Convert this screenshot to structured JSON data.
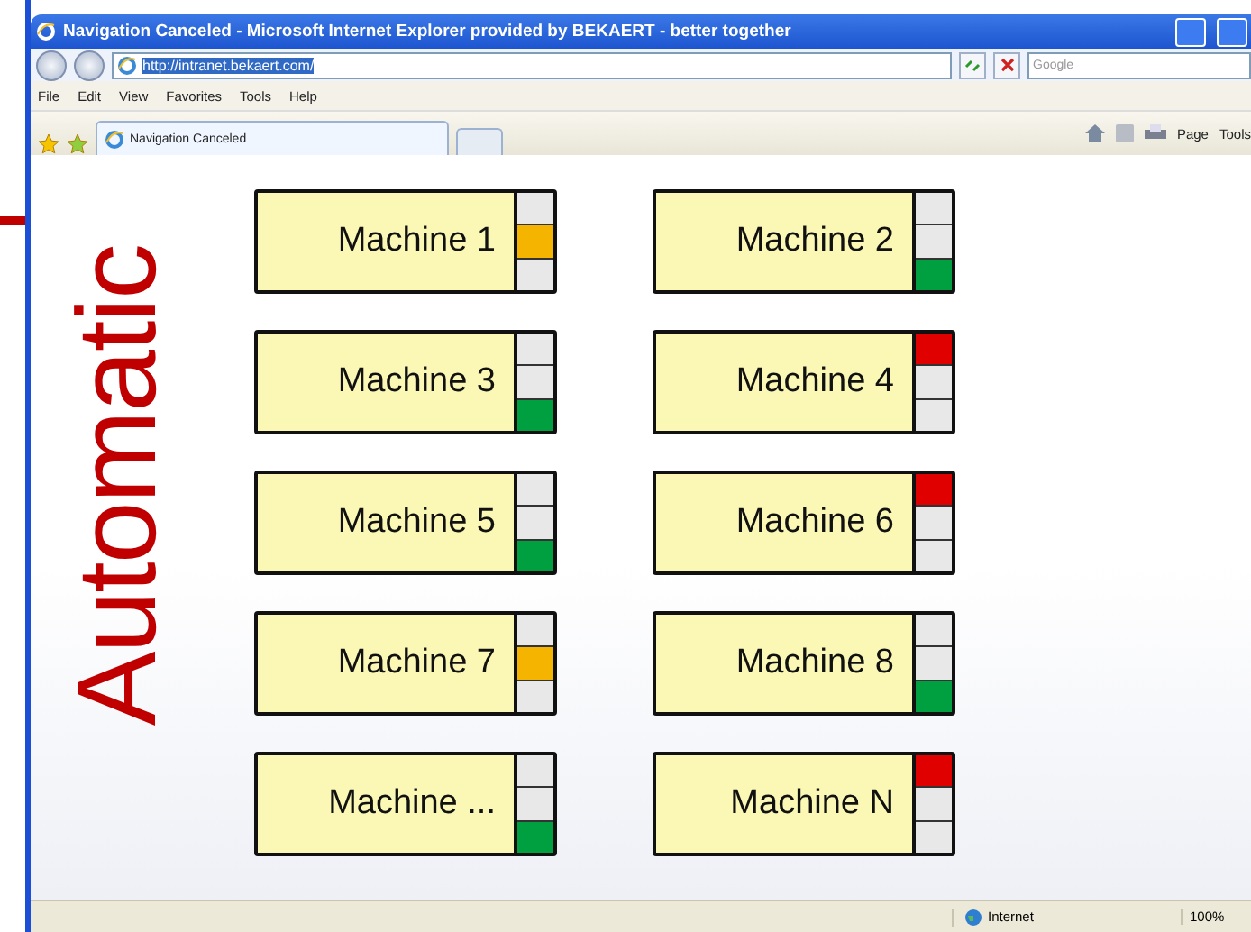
{
  "window": {
    "title": "Navigation Canceled - Microsoft Internet Explorer provided by BEKAERT - better together"
  },
  "address_bar": {
    "url": "http://intranet.bekaert.com/"
  },
  "search": {
    "placeholder": "Google"
  },
  "menu": [
    "File",
    "Edit",
    "View",
    "Favorites",
    "Tools",
    "Help"
  ],
  "tabs": [
    {
      "label": "Navigation Canceled",
      "selected": true
    }
  ],
  "command_bar": [
    "Page",
    "Tools"
  ],
  "page": {
    "heading": "Automatic",
    "machines": [
      {
        "name": "Machine 1",
        "lamps": [
          {
            "on": false
          },
          {
            "on": true
          },
          {
            "on": false
          }
        ]
      },
      {
        "name": "Machine 2",
        "lamps": [
          {
            "on": false
          },
          {
            "on": false
          },
          {
            "on": true
          }
        ]
      },
      {
        "name": "Machine 3",
        "lamps": [
          {
            "on": false
          },
          {
            "on": false
          },
          {
            "on": true
          }
        ]
      },
      {
        "name": "Machine 4",
        "lamps": [
          {
            "on": true
          },
          {
            "on": false
          },
          {
            "on": false
          }
        ]
      },
      {
        "name": "Machine 5",
        "lamps": [
          {
            "on": false
          },
          {
            "on": false
          },
          {
            "on": true
          }
        ]
      },
      {
        "name": "Machine 6",
        "lamps": [
          {
            "on": true
          },
          {
            "on": false
          },
          {
            "on": false
          }
        ]
      },
      {
        "name": "Machine 7",
        "lamps": [
          {
            "on": false
          },
          {
            "on": true
          },
          {
            "on": false
          }
        ]
      },
      {
        "name": "Machine 8",
        "lamps": [
          {
            "on": false
          },
          {
            "on": false
          },
          {
            "on": true
          }
        ]
      },
      {
        "name": "Machine ...",
        "lamps": [
          {
            "on": false
          },
          {
            "on": false
          },
          {
            "on": true
          }
        ]
      },
      {
        "name": "Machine N",
        "lamps": [
          {
            "on": true
          },
          {
            "on": false
          },
          {
            "on": false
          }
        ]
      }
    ]
  },
  "status_bar": {
    "zone": "Internet",
    "zoom": "100%"
  }
}
